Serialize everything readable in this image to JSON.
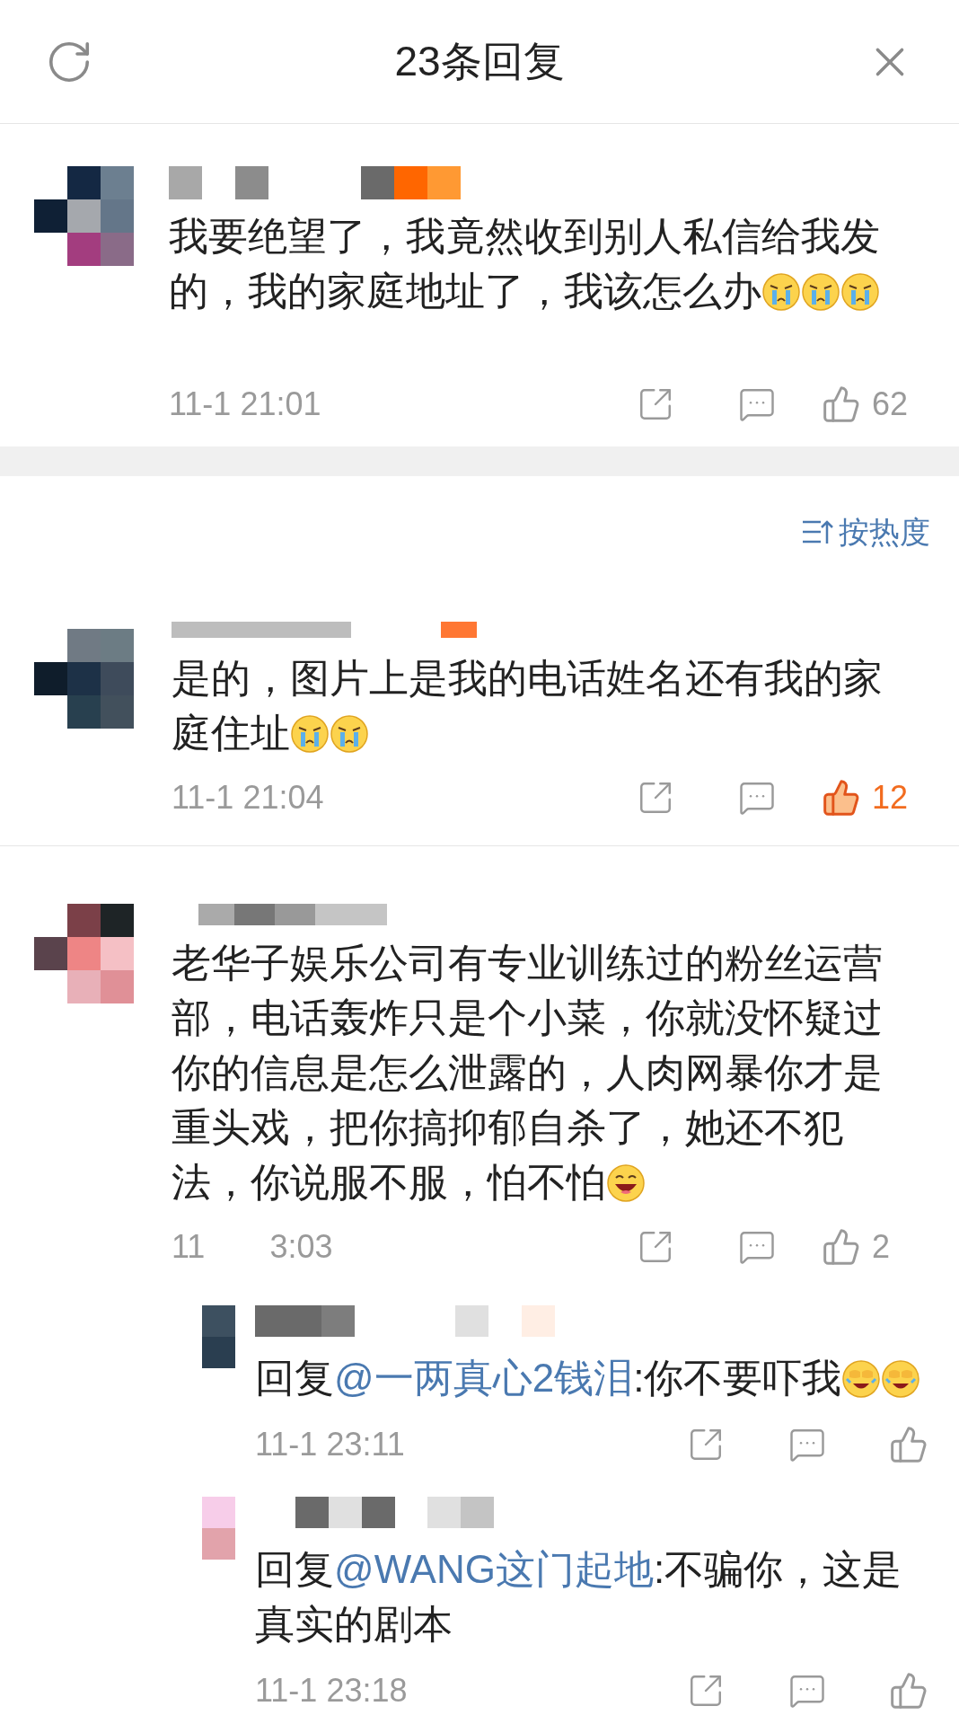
{
  "header": {
    "title": "23条回复"
  },
  "root_comment": {
    "text": "我要绝望了，我竟然收到别人私信给我发的，我的家庭地址了，我该怎么办",
    "emojis": [
      {
        "kind": "crying"
      },
      {
        "kind": "crying"
      },
      {
        "kind": "crying"
      }
    ],
    "time": [
      "11-1 21:01"
    ],
    "likes": "62",
    "liked": false
  },
  "sort": {
    "label": "按热度"
  },
  "comments": [
    {
      "text": "是的，图片上是我的电话姓名还有我的家庭住址",
      "emojis": [
        {
          "kind": "crying"
        },
        {
          "kind": "crying"
        }
      ],
      "time": [
        "11-1 21:04"
      ],
      "likes": "12",
      "liked": true
    },
    {
      "text": "老华子娱乐公司有专业训练过的粉丝运营部，电话轰炸只是个小菜，你就没怀疑过你的信息是怎么泄露的，人肉网暴你才是重头戏，把你搞抑郁自杀了，她还不犯法，你说服不服，怕不怕",
      "emojis": [
        {
          "kind": "grinning"
        }
      ],
      "time": [
        "11",
        "3:03"
      ],
      "likes": "2",
      "liked": false,
      "replies": [
        {
          "prefix": "回复",
          "mention": "@一两真心2钱泪",
          "text": ":你不要吓我",
          "emojis": [
            {
              "kind": "laughing-crying"
            },
            {
              "kind": "laughing-crying"
            }
          ],
          "time": [
            "11-1 23:11"
          ],
          "liked": false
        },
        {
          "prefix": "回复",
          "mention": "@WANG这门起地",
          "text": ":不骗你，这是真实的剧本",
          "time": [
            "11-1 23:18"
          ],
          "liked": false
        }
      ]
    }
  ]
}
